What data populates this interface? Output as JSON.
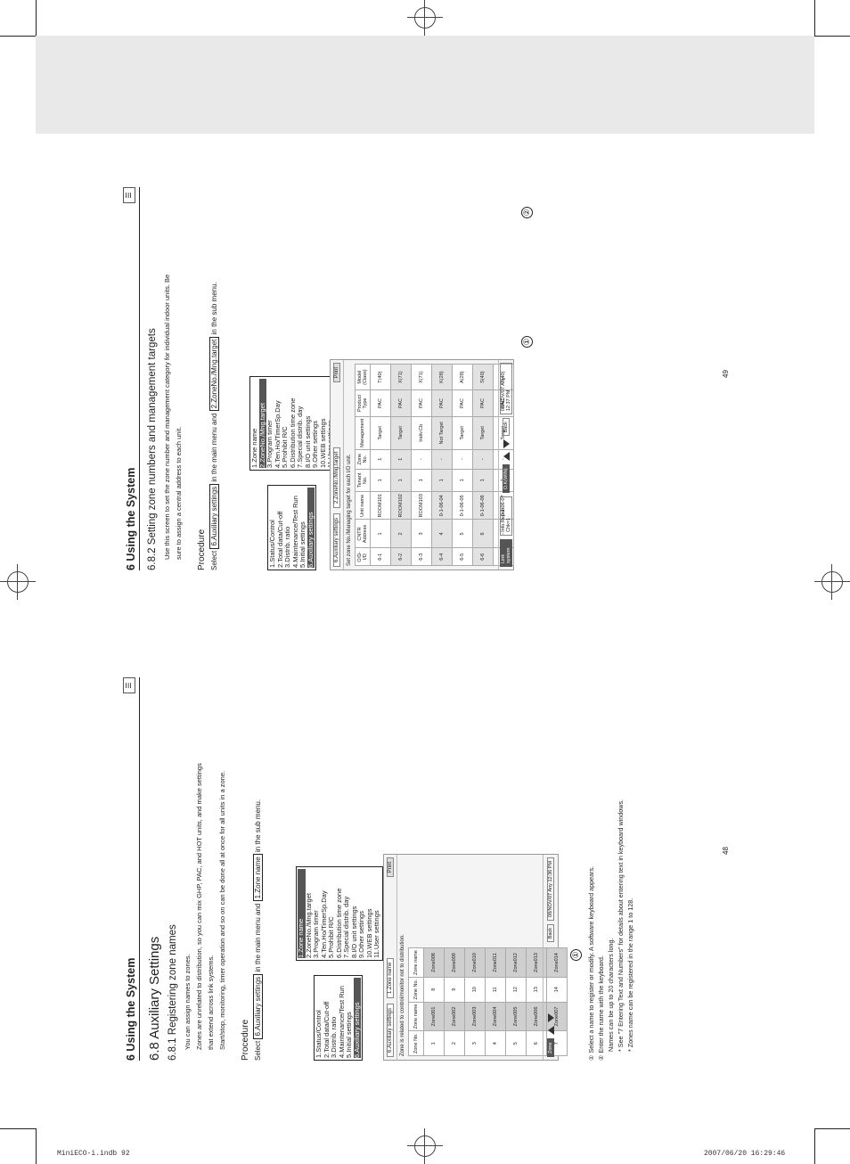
{
  "footer": {
    "left": "MiniECO-i.indb   92",
    "right": "2007/06/20   16:29:46"
  },
  "page_numbers": {
    "left": "48",
    "right": "49"
  },
  "left_page": {
    "chapter": "6 Using the System",
    "section": "6.8 Auxiliary Settings",
    "subsection": "6.8.1 Registering zone names",
    "paragraphs": [
      "You can assign names to zones.",
      "Zones are unrelated to distribution, so you can mix GHP, PAC, and HOT units, and make settings",
      "that extend across link systems.",
      "Start/stop, monitoring, timer operation and so on can be done all at once for all units in a zone."
    ],
    "procedure_heading": "Procedure",
    "procedure": {
      "pre": "Select",
      "main": "6.Auxiliary settings",
      "mid": "in the main menu and",
      "sub": "1.Zone name",
      "post": "in the sub menu."
    },
    "main_menu": [
      "1.Status/Control",
      "2.Total data/Cut-off",
      "3.Distrib. ratio",
      "4.Maintenance/Test Run",
      "5.Initial settings",
      "6.Auxiliary settings"
    ],
    "sub_menu": [
      "1.Zone name",
      "2.ZoneNo./Mng.target",
      "3.Program timer",
      "4.Ten.Ho/TimerSp.Day",
      "5.Prohibit R/C",
      "6.Distribution time zone",
      "7.Special distrib. day",
      "8.I/O unit settings",
      "9.Other settings",
      "10.WEB settings",
      "11.User settings"
    ],
    "screen": {
      "dropdown1": "6.Auxiliary settings",
      "dropdown2": "1.Zone name",
      "print": "Print",
      "info": "Zone is related to control/monitor not to distribution.",
      "headers": [
        "Zone No.",
        "Zone name",
        "Zone No.",
        "Zone name"
      ],
      "rows": [
        [
          "1",
          "Zone001",
          "8",
          "Zone008"
        ],
        [
          "2",
          "Zone002",
          "9",
          "Zone009"
        ],
        [
          "3",
          "Zone003",
          "10",
          "Zone010"
        ],
        [
          "4",
          "Zone004",
          "11",
          "Zone011"
        ],
        [
          "5",
          "Zone005",
          "12",
          "Zone012"
        ],
        [
          "6",
          "Zone006",
          "13",
          "Zone013"
        ],
        [
          "7",
          "Zone007",
          "14",
          "Zone014"
        ]
      ],
      "left_button": "Zone",
      "back": "Back",
      "timestamp": "08/NOV/07 Any 12:36 PM"
    },
    "notes": [
      "① Select a name to register or modify. A software keyboard appears.",
      "② Enter the name with the keyboard.",
      "Names can be up to 20 characters long.",
      "* See \"7 Entering Text and Numbers\" for details about entering text in keyboard windows.",
      "* Zones name can be registered in the range 1 to 128."
    ],
    "callout": "①"
  },
  "right_page": {
    "chapter": "6 Using the System",
    "subsection": "6.8.2 Setting zone numbers and management targets",
    "paragraphs": [
      "Use this screen to set the zone number and management category for individual indoor units. Be",
      "sure to assign a central address to each unit."
    ],
    "procedure_heading": "Procedure",
    "procedure": {
      "pre": "Select",
      "main": "6.Auxiliary settings",
      "mid": "in the main menu and",
      "sub": "2.ZoneNo./Mng.target",
      "post": "in the sub menu."
    },
    "main_menu": [
      "1.Status/Control",
      "2.Total data/Cut-off",
      "3.Distrib. ratio",
      "4.Maintenance/Test Run",
      "5.Initial settings",
      "6.Auxiliary settings"
    ],
    "sub_menu": [
      "1.Zone name",
      "2.ZoneNo./Mng.target",
      "3.Program timer",
      "4.Ten.Ho/TimerSp.Day",
      "5.Prohibit R/C",
      "6.Distribution time zone",
      "7.Special distrib. day",
      "8.I/O unit settings",
      "9.Other settings",
      "10.WEB settings",
      "11.User settings"
    ],
    "screen": {
      "dropdown1": "6.Auxiliary settings",
      "dropdown2": "2.ZoneNo./Mng.target",
      "print": "Print",
      "info": "Set zone No./Managing target for each I/D unit.",
      "headers": [
        "O/D-I/D",
        "CNTR Address",
        "Unit name",
        "Tenant No.",
        "Zone No.",
        "Management",
        "Product Type",
        "Model (Class)"
      ],
      "rows": [
        [
          "6-1",
          "1",
          "ROOM101",
          "1",
          "1",
          "Target",
          "PAC",
          "T(40)"
        ],
        [
          "6-2",
          "2",
          "ROOM102",
          "1",
          "1",
          "Target",
          "PAC",
          "X(71)"
        ],
        [
          "6-3",
          "3",
          "ROOM103",
          "1",
          "-",
          "Indiv.Cb",
          "PAC",
          "X(71)"
        ],
        [
          "6-4",
          "4",
          "0-1-06-04",
          "1",
          "-",
          "Not Target",
          "PAC",
          "K(28)"
        ],
        [
          "6-5",
          "5",
          "0-1-06-05",
          "1",
          "-",
          "Target",
          "PAC",
          "A(28)"
        ],
        [
          "6-6",
          "6",
          "0-1-06-06",
          "1",
          "-",
          "Target",
          "PAC",
          "S(40)"
        ],
        [
          "6-7",
          "-",
          "0-1-06-07",
          "1",
          "-",
          "Target",
          "PAC",
          "T(40)"
        ]
      ],
      "left_button": "Link system",
      "info_button": "Info.Report Chk=1",
      "ok_button": "O.K(WIN)",
      "back": "Back",
      "timestamp": "08/NOV/07 Any 12:37 PM"
    },
    "callouts": [
      "①",
      "②"
    ]
  }
}
